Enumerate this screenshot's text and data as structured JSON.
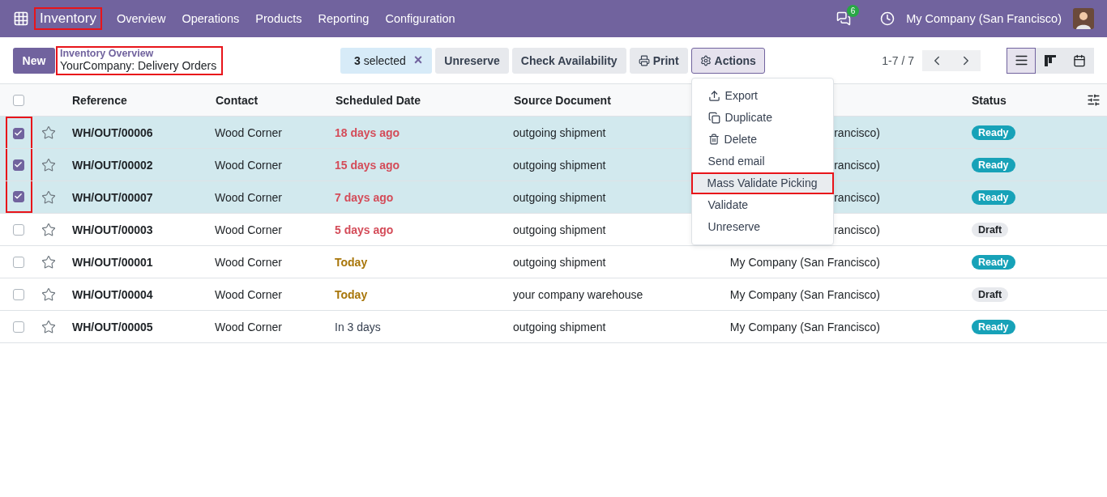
{
  "navbar": {
    "app": {
      "label": "Inventory",
      "highlighted": true
    },
    "menu": [
      "Overview",
      "Operations",
      "Products",
      "Reporting",
      "Configuration"
    ],
    "messages_badge": "6",
    "company": "My Company (San Francisco)"
  },
  "control_panel": {
    "new_button": "New",
    "breadcrumb": {
      "parent": "Inventory Overview",
      "current": "YourCompany: Delivery Orders",
      "highlighted": true
    },
    "selection": {
      "count": "3",
      "label": "selected",
      "clear": "×"
    },
    "buttons": [
      {
        "label": "Unreserve",
        "kind": "plain",
        "expanded": false
      },
      {
        "label": "Check Availability",
        "kind": "plain",
        "expanded": false
      },
      {
        "label": "Print",
        "kind": "print",
        "expanded": false
      },
      {
        "label": "Actions",
        "kind": "actions",
        "expanded": true
      }
    ],
    "pager": "1-7 / 7",
    "views": [
      {
        "kind": "list",
        "selected": true
      },
      {
        "kind": "kanban",
        "selected": false
      },
      {
        "kind": "calendar",
        "selected": false
      }
    ]
  },
  "actions_menu": [
    {
      "label": "Export",
      "kind": "export",
      "highlighted": false
    },
    {
      "label": "Duplicate",
      "kind": "duplicate",
      "highlighted": false
    },
    {
      "label": "Delete",
      "kind": "delete",
      "highlighted": false
    },
    {
      "label": "Send email",
      "kind": "plain",
      "highlighted": false
    },
    {
      "label": "Mass Validate Picking",
      "kind": "plain",
      "highlighted": true
    },
    {
      "label": "Validate",
      "kind": "plain",
      "highlighted": false
    },
    {
      "label": "Unreserve",
      "kind": "plain",
      "highlighted": false
    }
  ],
  "table": {
    "header_checked": false,
    "columns": {
      "reference": "Reference",
      "contact": "Contact",
      "scheduled_date": "Scheduled Date",
      "source_document": "Source Document",
      "status": "Status"
    },
    "rows": [
      {
        "reference": "WH/OUT/00006",
        "contact": "Wood Corner",
        "date": {
          "text": "18 days ago",
          "color": "#d44c59",
          "bold": true
        },
        "source": "outgoing shipment",
        "company": "rancisco)",
        "status": {
          "label": "Ready",
          "kind": "ready"
        },
        "selected": true,
        "highlighted": true
      },
      {
        "reference": "WH/OUT/00002",
        "contact": "Wood Corner",
        "date": {
          "text": "15 days ago",
          "color": "#d44c59",
          "bold": true
        },
        "source": "outgoing shipment",
        "company": "rancisco)",
        "status": {
          "label": "Ready",
          "kind": "ready"
        },
        "selected": true,
        "highlighted": true
      },
      {
        "reference": "WH/OUT/00007",
        "contact": "Wood Corner",
        "date": {
          "text": "7 days ago",
          "color": "#d44c59",
          "bold": true
        },
        "source": "outgoing shipment",
        "company": "rancisco)",
        "status": {
          "label": "Ready",
          "kind": "ready"
        },
        "selected": true,
        "highlighted": true
      },
      {
        "reference": "WH/OUT/00003",
        "contact": "Wood Corner",
        "date": {
          "text": "5 days ago",
          "color": "#d44c59",
          "bold": true
        },
        "source": "outgoing shipment",
        "company": "rancisco)",
        "status": {
          "label": "Draft",
          "kind": "draft"
        },
        "selected": false,
        "highlighted": false
      },
      {
        "reference": "WH/OUT/00001",
        "contact": "Wood Corner",
        "date": {
          "text": "Today",
          "color": "#a8760a",
          "bold": true
        },
        "source": "outgoing shipment",
        "company": "My Company (San Francisco)",
        "status": {
          "label": "Ready",
          "kind": "ready"
        },
        "selected": false,
        "highlighted": false
      },
      {
        "reference": "WH/OUT/00004",
        "contact": "Wood Corner",
        "date": {
          "text": "Today",
          "color": "#a8760a",
          "bold": true
        },
        "source": "your company warehouse",
        "company": "My Company (San Francisco)",
        "status": {
          "label": "Draft",
          "kind": "draft"
        },
        "selected": false,
        "highlighted": false
      },
      {
        "reference": "WH/OUT/00005",
        "contact": "Wood Corner",
        "date": {
          "text": "In 3 days",
          "color": "#374151",
          "bold": false
        },
        "source": "outgoing shipment",
        "company": "My Company (San Francisco)",
        "status": {
          "label": "Ready",
          "kind": "ready"
        },
        "selected": false,
        "highlighted": false
      }
    ]
  }
}
